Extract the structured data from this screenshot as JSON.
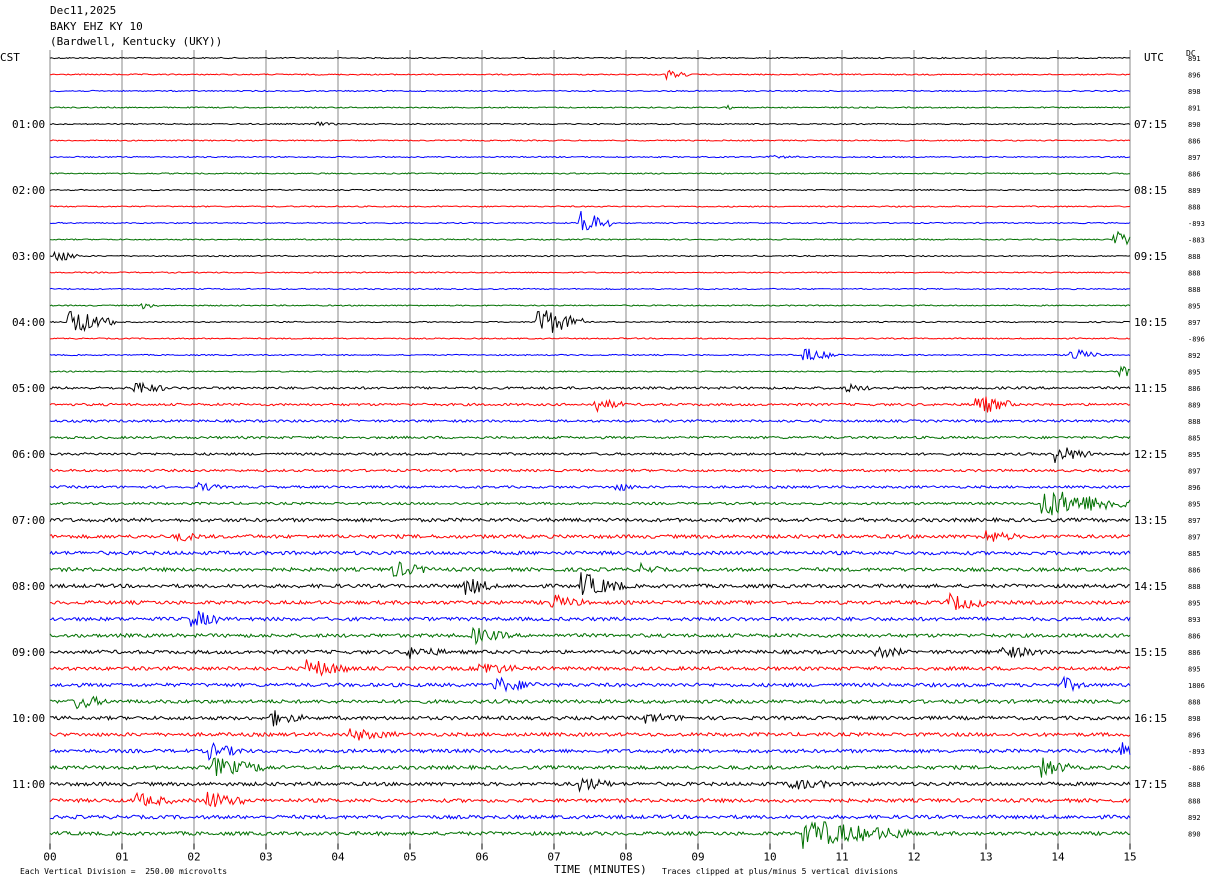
{
  "header": {
    "date": "Dec11,2025",
    "station": "BAKY EHZ KY 10",
    "location": "(Bardwell, Kentucky (UKY))"
  },
  "labels": {
    "left_zone": "CST",
    "right_zone": "UTC",
    "dc_label": "DC",
    "xlabel": "TIME (MINUTES)",
    "scale_note": "Each Vertical Division =  250.00 microvolts",
    "clip_note": "Traces clipped at plus/minus 5 vertical divisions"
  },
  "chart_data": {
    "type": "line",
    "title": "BAKY EHZ KY 10",
    "xlabel": "TIME (MINUTES)",
    "ylabel": "",
    "xlim": [
      0,
      15
    ],
    "x_ticks": [
      "00",
      "01",
      "02",
      "03",
      "04",
      "05",
      "06",
      "07",
      "08",
      "09",
      "10",
      "11",
      "12",
      "13",
      "14",
      "15"
    ],
    "row_count": 48,
    "row_minutes": 15,
    "trace_colors": [
      "#000000",
      "#ff0000",
      "#0000ff",
      "#007000"
    ],
    "left_time_labels": [
      {
        "row": 4,
        "label": "01:00"
      },
      {
        "row": 8,
        "label": "02:00"
      },
      {
        "row": 12,
        "label": "03:00"
      },
      {
        "row": 16,
        "label": "04:00"
      },
      {
        "row": 20,
        "label": "05:00"
      },
      {
        "row": 24,
        "label": "06:00"
      },
      {
        "row": 28,
        "label": "07:00"
      },
      {
        "row": 32,
        "label": "08:00"
      },
      {
        "row": 36,
        "label": "09:00"
      },
      {
        "row": 40,
        "label": "10:00"
      },
      {
        "row": 44,
        "label": "11:00"
      }
    ],
    "right_time_labels": [
      {
        "row": 4,
        "label": "07:15"
      },
      {
        "row": 8,
        "label": "08:15"
      },
      {
        "row": 12,
        "label": "09:15"
      },
      {
        "row": 16,
        "label": "10:15"
      },
      {
        "row": 20,
        "label": "11:15"
      },
      {
        "row": 24,
        "label": "12:15"
      },
      {
        "row": 28,
        "label": "13:15"
      },
      {
        "row": 32,
        "label": "14:15"
      },
      {
        "row": 36,
        "label": "15:15"
      },
      {
        "row": 40,
        "label": "16:15"
      },
      {
        "row": 44,
        "label": "17:15"
      }
    ],
    "dc_values": [
      "891",
      "896",
      "898",
      "891",
      "890",
      "886",
      "897",
      "886",
      "889",
      "888",
      "-893",
      "-883",
      "888",
      "888",
      "888",
      "895",
      "897",
      "-896",
      "892",
      "895",
      "886",
      "889",
      "888",
      "885",
      "895",
      "897",
      "896",
      "895",
      "897",
      "897",
      "885",
      "886",
      "888",
      "895",
      "893",
      "886",
      "886",
      "895",
      "1806",
      "888",
      "898",
      "896",
      "-893",
      "-886",
      "888",
      "888",
      "892",
      "890"
    ],
    "events": [
      {
        "row": 1,
        "minute": 8.6,
        "amp": 1.2,
        "dur": 0.3
      },
      {
        "row": 3,
        "minute": 9.4,
        "amp": 0.5,
        "dur": 0.2
      },
      {
        "row": 4,
        "minute": 3.7,
        "amp": 0.5,
        "dur": 0.3
      },
      {
        "row": 6,
        "minute": 10.0,
        "amp": 0.4,
        "dur": 0.4
      },
      {
        "row": 10,
        "minute": 7.4,
        "amp": 4.0,
        "dur": 0.4
      },
      {
        "row": 11,
        "minute": 14.8,
        "amp": 3.0,
        "dur": 0.4
      },
      {
        "row": 12,
        "minute": 0.1,
        "amp": 2.0,
        "dur": 0.3
      },
      {
        "row": 15,
        "minute": 1.3,
        "amp": 0.8,
        "dur": 0.2
      },
      {
        "row": 16,
        "minute": 0.3,
        "amp": 4.0,
        "dur": 0.6
      },
      {
        "row": 16,
        "minute": 6.8,
        "amp": 5.0,
        "dur": 0.6
      },
      {
        "row": 18,
        "minute": 10.5,
        "amp": 2.0,
        "dur": 0.5
      },
      {
        "row": 18,
        "minute": 14.2,
        "amp": 2.0,
        "dur": 0.4
      },
      {
        "row": 19,
        "minute": 14.9,
        "amp": 2.0,
        "dur": 0.2
      },
      {
        "row": 20,
        "minute": 1.2,
        "amp": 2.0,
        "dur": 0.4
      },
      {
        "row": 20,
        "minute": 11.1,
        "amp": 1.0,
        "dur": 0.3
      },
      {
        "row": 21,
        "minute": 7.6,
        "amp": 1.8,
        "dur": 0.4
      },
      {
        "row": 21,
        "minute": 12.9,
        "amp": 3.0,
        "dur": 0.5
      },
      {
        "row": 24,
        "minute": 14.0,
        "amp": 2.5,
        "dur": 0.5
      },
      {
        "row": 26,
        "minute": 2.1,
        "amp": 1.2,
        "dur": 0.3
      },
      {
        "row": 26,
        "minute": 7.9,
        "amp": 1.0,
        "dur": 0.3
      },
      {
        "row": 27,
        "minute": 13.8,
        "amp": 4.0,
        "dur": 1.5
      },
      {
        "row": 29,
        "minute": 1.8,
        "amp": 1.2,
        "dur": 0.3
      },
      {
        "row": 29,
        "minute": 13.0,
        "amp": 1.8,
        "dur": 0.4
      },
      {
        "row": 31,
        "minute": 4.8,
        "amp": 2.0,
        "dur": 0.5
      },
      {
        "row": 31,
        "minute": 8.2,
        "amp": 1.3,
        "dur": 0.3
      },
      {
        "row": 32,
        "minute": 5.8,
        "amp": 2.5,
        "dur": 0.4
      },
      {
        "row": 32,
        "minute": 7.4,
        "amp": 3.5,
        "dur": 0.6
      },
      {
        "row": 33,
        "minute": 7.0,
        "amp": 2.0,
        "dur": 0.4
      },
      {
        "row": 33,
        "minute": 12.5,
        "amp": 2.2,
        "dur": 0.6
      },
      {
        "row": 34,
        "minute": 2.0,
        "amp": 2.5,
        "dur": 0.4
      },
      {
        "row": 35,
        "minute": 5.9,
        "amp": 2.0,
        "dur": 0.5
      },
      {
        "row": 36,
        "minute": 5.0,
        "amp": 1.5,
        "dur": 0.5
      },
      {
        "row": 36,
        "minute": 11.5,
        "amp": 1.5,
        "dur": 0.4
      },
      {
        "row": 36,
        "minute": 13.2,
        "amp": 1.8,
        "dur": 0.6
      },
      {
        "row": 37,
        "minute": 3.6,
        "amp": 2.5,
        "dur": 0.6
      },
      {
        "row": 37,
        "minute": 6.0,
        "amp": 1.8,
        "dur": 0.5
      },
      {
        "row": 38,
        "minute": 6.2,
        "amp": 2.0,
        "dur": 0.6
      },
      {
        "row": 38,
        "minute": 14.1,
        "amp": 1.8,
        "dur": 0.3
      },
      {
        "row": 39,
        "minute": 0.4,
        "amp": 2.0,
        "dur": 0.4
      },
      {
        "row": 40,
        "minute": 3.1,
        "amp": 2.0,
        "dur": 0.4
      },
      {
        "row": 40,
        "minute": 8.3,
        "amp": 1.2,
        "dur": 0.5
      },
      {
        "row": 41,
        "minute": 4.2,
        "amp": 1.5,
        "dur": 0.6
      },
      {
        "row": 42,
        "minute": 2.2,
        "amp": 2.2,
        "dur": 0.5
      },
      {
        "row": 42,
        "minute": 14.9,
        "amp": 2.0,
        "dur": 0.2
      },
      {
        "row": 43,
        "minute": 2.3,
        "amp": 2.5,
        "dur": 0.8
      },
      {
        "row": 43,
        "minute": 13.8,
        "amp": 2.5,
        "dur": 0.4
      },
      {
        "row": 44,
        "minute": 7.4,
        "amp": 2.0,
        "dur": 0.4
      },
      {
        "row": 44,
        "minute": 10.3,
        "amp": 1.5,
        "dur": 0.6
      },
      {
        "row": 45,
        "minute": 1.2,
        "amp": 2.0,
        "dur": 0.5
      },
      {
        "row": 45,
        "minute": 2.2,
        "amp": 2.5,
        "dur": 0.5
      },
      {
        "row": 47,
        "minute": 10.5,
        "amp": 4.0,
        "dur": 1.5
      }
    ]
  }
}
